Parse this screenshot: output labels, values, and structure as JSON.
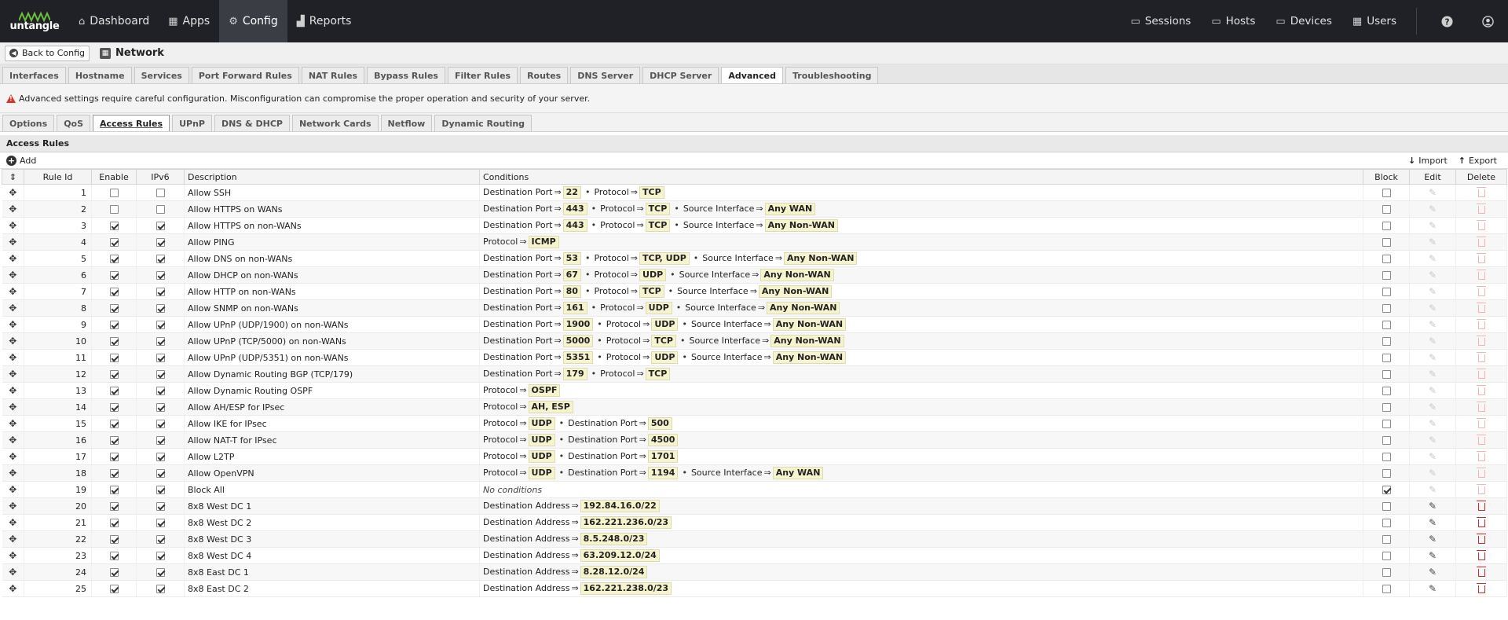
{
  "nav": {
    "logo_text": "untangle",
    "items": [
      {
        "label": "Dashboard",
        "icon": "home-icon",
        "glyph": "⌂"
      },
      {
        "label": "Apps",
        "icon": "grid-icon",
        "glyph": "▦"
      },
      {
        "label": "Config",
        "icon": "gear-icon",
        "glyph": "⚙"
      },
      {
        "label": "Reports",
        "icon": "chart-icon",
        "glyph": "▟"
      }
    ],
    "right_items": [
      {
        "label": "Sessions",
        "icon": "sessions-icon",
        "glyph": "▭"
      },
      {
        "label": "Hosts",
        "icon": "hosts-icon",
        "glyph": "▭"
      },
      {
        "label": "Devices",
        "icon": "devices-icon",
        "glyph": "▭"
      },
      {
        "label": "Users",
        "icon": "users-icon",
        "glyph": "▦"
      }
    ]
  },
  "titlebar": {
    "back_label": "Back to Config",
    "title": "Network"
  },
  "tabs": [
    "Interfaces",
    "Hostname",
    "Services",
    "Port Forward Rules",
    "NAT Rules",
    "Bypass Rules",
    "Filter Rules",
    "Routes",
    "DNS Server",
    "DHCP Server",
    "Advanced",
    "Troubleshooting"
  ],
  "active_tab": "Advanced",
  "warning": "Advanced settings require careful configuration. Misconfiguration can compromise the proper operation and security of your server.",
  "subtabs": [
    "Options",
    "QoS",
    "Access Rules",
    "UPnP",
    "DNS & DHCP",
    "Network Cards",
    "Netflow",
    "Dynamic Routing"
  ],
  "active_subtab": "Access Rules",
  "panel": {
    "title": "Access Rules",
    "add_label": "Add",
    "import_label": "Import",
    "export_label": "Export"
  },
  "columns": {
    "rule_id": "Rule Id",
    "enable": "Enable",
    "ipv6": "IPv6",
    "description": "Description",
    "conditions": "Conditions",
    "block": "Block",
    "edit": "Edit",
    "delete": "Delete"
  },
  "no_conditions": "No conditions",
  "rows": [
    {
      "id": "1",
      "enable": false,
      "ipv6": false,
      "desc": "Allow SSH",
      "block": false,
      "editable": false,
      "conds": [
        [
          "Destination Port",
          "22"
        ],
        [
          "Protocol",
          "TCP"
        ]
      ]
    },
    {
      "id": "2",
      "enable": false,
      "ipv6": false,
      "desc": "Allow HTTPS on WANs",
      "block": false,
      "editable": false,
      "conds": [
        [
          "Destination Port",
          "443"
        ],
        [
          "Protocol",
          "TCP"
        ],
        [
          "Source Interface",
          "Any WAN"
        ]
      ]
    },
    {
      "id": "3",
      "enable": true,
      "ipv6": true,
      "desc": "Allow HTTPS on non-WANs",
      "block": false,
      "editable": false,
      "conds": [
        [
          "Destination Port",
          "443"
        ],
        [
          "Protocol",
          "TCP"
        ],
        [
          "Source Interface",
          "Any Non-WAN"
        ]
      ]
    },
    {
      "id": "4",
      "enable": true,
      "ipv6": true,
      "desc": "Allow PING",
      "block": false,
      "editable": false,
      "conds": [
        [
          "Protocol",
          "ICMP"
        ]
      ]
    },
    {
      "id": "5",
      "enable": true,
      "ipv6": true,
      "desc": "Allow DNS on non-WANs",
      "block": false,
      "editable": false,
      "conds": [
        [
          "Destination Port",
          "53"
        ],
        [
          "Protocol",
          "TCP, UDP"
        ],
        [
          "Source Interface",
          "Any Non-WAN"
        ]
      ]
    },
    {
      "id": "6",
      "enable": true,
      "ipv6": true,
      "desc": "Allow DHCP on non-WANs",
      "block": false,
      "editable": false,
      "conds": [
        [
          "Destination Port",
          "67"
        ],
        [
          "Protocol",
          "UDP"
        ],
        [
          "Source Interface",
          "Any Non-WAN"
        ]
      ]
    },
    {
      "id": "7",
      "enable": true,
      "ipv6": true,
      "desc": "Allow HTTP on non-WANs",
      "block": false,
      "editable": false,
      "conds": [
        [
          "Destination Port",
          "80"
        ],
        [
          "Protocol",
          "TCP"
        ],
        [
          "Source Interface",
          "Any Non-WAN"
        ]
      ]
    },
    {
      "id": "8",
      "enable": true,
      "ipv6": true,
      "desc": "Allow SNMP on non-WANs",
      "block": false,
      "editable": false,
      "conds": [
        [
          "Destination Port",
          "161"
        ],
        [
          "Protocol",
          "UDP"
        ],
        [
          "Source Interface",
          "Any Non-WAN"
        ]
      ]
    },
    {
      "id": "9",
      "enable": true,
      "ipv6": true,
      "desc": "Allow UPnP (UDP/1900) on non-WANs",
      "block": false,
      "editable": false,
      "conds": [
        [
          "Destination Port",
          "1900"
        ],
        [
          "Protocol",
          "UDP"
        ],
        [
          "Source Interface",
          "Any Non-WAN"
        ]
      ]
    },
    {
      "id": "10",
      "enable": true,
      "ipv6": true,
      "desc": "Allow UPnP (TCP/5000) on non-WANs",
      "block": false,
      "editable": false,
      "conds": [
        [
          "Destination Port",
          "5000"
        ],
        [
          "Protocol",
          "TCP"
        ],
        [
          "Source Interface",
          "Any Non-WAN"
        ]
      ]
    },
    {
      "id": "11",
      "enable": true,
      "ipv6": true,
      "desc": "Allow UPnP (UDP/5351) on non-WANs",
      "block": false,
      "editable": false,
      "conds": [
        [
          "Destination Port",
          "5351"
        ],
        [
          "Protocol",
          "UDP"
        ],
        [
          "Source Interface",
          "Any Non-WAN"
        ]
      ]
    },
    {
      "id": "12",
      "enable": true,
      "ipv6": true,
      "desc": "Allow Dynamic Routing BGP (TCP/179)",
      "block": false,
      "editable": false,
      "conds": [
        [
          "Destination Port",
          "179"
        ],
        [
          "Protocol",
          "TCP"
        ]
      ]
    },
    {
      "id": "13",
      "enable": true,
      "ipv6": true,
      "desc": "Allow Dynamic Routing OSPF",
      "block": false,
      "editable": false,
      "conds": [
        [
          "Protocol",
          "OSPF"
        ]
      ]
    },
    {
      "id": "14",
      "enable": true,
      "ipv6": true,
      "desc": "Allow AH/ESP for IPsec",
      "block": false,
      "editable": false,
      "conds": [
        [
          "Protocol",
          "AH, ESP"
        ]
      ]
    },
    {
      "id": "15",
      "enable": true,
      "ipv6": true,
      "desc": "Allow IKE for IPsec",
      "block": false,
      "editable": false,
      "conds": [
        [
          "Protocol",
          "UDP"
        ],
        [
          "Destination Port",
          "500"
        ]
      ]
    },
    {
      "id": "16",
      "enable": true,
      "ipv6": true,
      "desc": "Allow NAT-T for IPsec",
      "block": false,
      "editable": false,
      "conds": [
        [
          "Protocol",
          "UDP"
        ],
        [
          "Destination Port",
          "4500"
        ]
      ]
    },
    {
      "id": "17",
      "enable": true,
      "ipv6": true,
      "desc": "Allow L2TP",
      "block": false,
      "editable": false,
      "conds": [
        [
          "Protocol",
          "UDP"
        ],
        [
          "Destination Port",
          "1701"
        ]
      ]
    },
    {
      "id": "18",
      "enable": true,
      "ipv6": true,
      "desc": "Allow OpenVPN",
      "block": false,
      "editable": false,
      "conds": [
        [
          "Protocol",
          "UDP"
        ],
        [
          "Destination Port",
          "1194"
        ],
        [
          "Source Interface",
          "Any WAN"
        ]
      ]
    },
    {
      "id": "19",
      "enable": true,
      "ipv6": true,
      "desc": "Block All",
      "block": true,
      "editable": false,
      "conds": []
    },
    {
      "id": "20",
      "enable": true,
      "ipv6": true,
      "desc": "8x8 West DC 1",
      "block": false,
      "editable": true,
      "conds": [
        [
          "Destination Address",
          "192.84.16.0/22"
        ]
      ]
    },
    {
      "id": "21",
      "enable": true,
      "ipv6": true,
      "desc": "8x8 West DC 2",
      "block": false,
      "editable": true,
      "conds": [
        [
          "Destination Address",
          "162.221.236.0/23"
        ]
      ]
    },
    {
      "id": "22",
      "enable": true,
      "ipv6": true,
      "desc": "8x8 West DC 3",
      "block": false,
      "editable": true,
      "conds": [
        [
          "Destination Address",
          "8.5.248.0/23"
        ]
      ]
    },
    {
      "id": "23",
      "enable": true,
      "ipv6": true,
      "desc": "8x8 West DC 4",
      "block": false,
      "editable": true,
      "conds": [
        [
          "Destination Address",
          "63.209.12.0/24"
        ]
      ]
    },
    {
      "id": "24",
      "enable": true,
      "ipv6": true,
      "desc": "8x8 East DC 1",
      "block": false,
      "editable": true,
      "conds": [
        [
          "Destination Address",
          "8.28.12.0/24"
        ]
      ]
    },
    {
      "id": "25",
      "enable": true,
      "ipv6": true,
      "desc": "8x8 East DC 2",
      "block": false,
      "editable": true,
      "conds": [
        [
          "Destination Address",
          "162.221.238.0/23"
        ]
      ]
    }
  ]
}
